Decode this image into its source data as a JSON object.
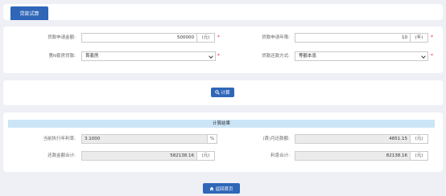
{
  "tab": {
    "label": "贷款试算"
  },
  "form": {
    "loan_amount": {
      "label": "贷款申请金额:",
      "value": "500000",
      "unit": "(元)"
    },
    "loan_years": {
      "label": "贷款申请年限:",
      "value": "10",
      "unit": "(年)"
    },
    "house_nth": {
      "label": "第N套房贷款:",
      "selected": "首套房"
    },
    "repay_method": {
      "label": "贷款还款方式:",
      "selected": "等额本息"
    },
    "required_mark": "*"
  },
  "action": {
    "calculate_label": "计算"
  },
  "results": {
    "header": "计算结果",
    "annual_rate": {
      "label": "当前执行年利率:",
      "value": "3.1000",
      "unit": "%"
    },
    "monthly_payment": {
      "label": "(首)月还款额:",
      "value": "4851.15",
      "unit": "(元)"
    },
    "total_repay": {
      "label": "还款金额合计:",
      "value": "582138.16",
      "unit": "(元)"
    },
    "total_interest": {
      "label": "利息合计:",
      "value": "82138.16",
      "unit": "(元)"
    }
  },
  "footer": {
    "home_label": "返回首页"
  },
  "colors": {
    "primary": "#2f66b8",
    "required": "#e53030",
    "result_header_bg": "#cbe5f7"
  },
  "icons": {
    "calculate": "search-icon",
    "home": "home-icon"
  }
}
